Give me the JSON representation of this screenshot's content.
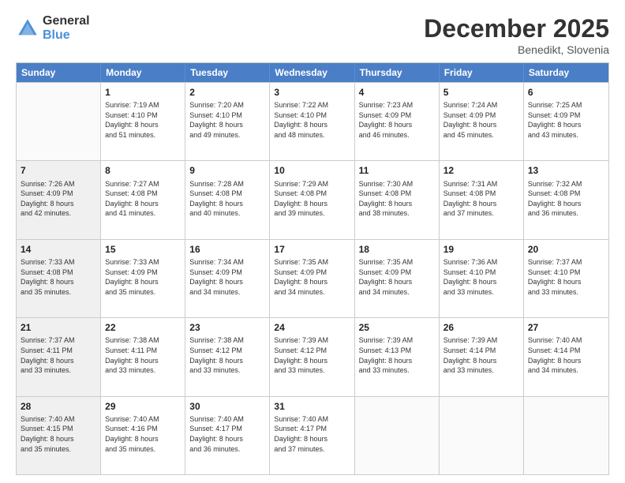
{
  "logo": {
    "general": "General",
    "blue": "Blue"
  },
  "header": {
    "title": "December 2025",
    "subtitle": "Benedikt, Slovenia"
  },
  "weekdays": [
    "Sunday",
    "Monday",
    "Tuesday",
    "Wednesday",
    "Thursday",
    "Friday",
    "Saturday"
  ],
  "rows": [
    [
      {
        "day": "",
        "info": "",
        "shaded": false,
        "empty": true
      },
      {
        "day": "1",
        "info": "Sunrise: 7:19 AM\nSunset: 4:10 PM\nDaylight: 8 hours\nand 51 minutes.",
        "shaded": false,
        "empty": false
      },
      {
        "day": "2",
        "info": "Sunrise: 7:20 AM\nSunset: 4:10 PM\nDaylight: 8 hours\nand 49 minutes.",
        "shaded": false,
        "empty": false
      },
      {
        "day": "3",
        "info": "Sunrise: 7:22 AM\nSunset: 4:10 PM\nDaylight: 8 hours\nand 48 minutes.",
        "shaded": false,
        "empty": false
      },
      {
        "day": "4",
        "info": "Sunrise: 7:23 AM\nSunset: 4:09 PM\nDaylight: 8 hours\nand 46 minutes.",
        "shaded": false,
        "empty": false
      },
      {
        "day": "5",
        "info": "Sunrise: 7:24 AM\nSunset: 4:09 PM\nDaylight: 8 hours\nand 45 minutes.",
        "shaded": false,
        "empty": false
      },
      {
        "day": "6",
        "info": "Sunrise: 7:25 AM\nSunset: 4:09 PM\nDaylight: 8 hours\nand 43 minutes.",
        "shaded": false,
        "empty": false
      }
    ],
    [
      {
        "day": "7",
        "info": "Sunrise: 7:26 AM\nSunset: 4:09 PM\nDaylight: 8 hours\nand 42 minutes.",
        "shaded": true,
        "empty": false
      },
      {
        "day": "8",
        "info": "Sunrise: 7:27 AM\nSunset: 4:08 PM\nDaylight: 8 hours\nand 41 minutes.",
        "shaded": false,
        "empty": false
      },
      {
        "day": "9",
        "info": "Sunrise: 7:28 AM\nSunset: 4:08 PM\nDaylight: 8 hours\nand 40 minutes.",
        "shaded": false,
        "empty": false
      },
      {
        "day": "10",
        "info": "Sunrise: 7:29 AM\nSunset: 4:08 PM\nDaylight: 8 hours\nand 39 minutes.",
        "shaded": false,
        "empty": false
      },
      {
        "day": "11",
        "info": "Sunrise: 7:30 AM\nSunset: 4:08 PM\nDaylight: 8 hours\nand 38 minutes.",
        "shaded": false,
        "empty": false
      },
      {
        "day": "12",
        "info": "Sunrise: 7:31 AM\nSunset: 4:08 PM\nDaylight: 8 hours\nand 37 minutes.",
        "shaded": false,
        "empty": false
      },
      {
        "day": "13",
        "info": "Sunrise: 7:32 AM\nSunset: 4:08 PM\nDaylight: 8 hours\nand 36 minutes.",
        "shaded": false,
        "empty": false
      }
    ],
    [
      {
        "day": "14",
        "info": "Sunrise: 7:33 AM\nSunset: 4:08 PM\nDaylight: 8 hours\nand 35 minutes.",
        "shaded": true,
        "empty": false
      },
      {
        "day": "15",
        "info": "Sunrise: 7:33 AM\nSunset: 4:09 PM\nDaylight: 8 hours\nand 35 minutes.",
        "shaded": false,
        "empty": false
      },
      {
        "day": "16",
        "info": "Sunrise: 7:34 AM\nSunset: 4:09 PM\nDaylight: 8 hours\nand 34 minutes.",
        "shaded": false,
        "empty": false
      },
      {
        "day": "17",
        "info": "Sunrise: 7:35 AM\nSunset: 4:09 PM\nDaylight: 8 hours\nand 34 minutes.",
        "shaded": false,
        "empty": false
      },
      {
        "day": "18",
        "info": "Sunrise: 7:35 AM\nSunset: 4:09 PM\nDaylight: 8 hours\nand 34 minutes.",
        "shaded": false,
        "empty": false
      },
      {
        "day": "19",
        "info": "Sunrise: 7:36 AM\nSunset: 4:10 PM\nDaylight: 8 hours\nand 33 minutes.",
        "shaded": false,
        "empty": false
      },
      {
        "day": "20",
        "info": "Sunrise: 7:37 AM\nSunset: 4:10 PM\nDaylight: 8 hours\nand 33 minutes.",
        "shaded": false,
        "empty": false
      }
    ],
    [
      {
        "day": "21",
        "info": "Sunrise: 7:37 AM\nSunset: 4:11 PM\nDaylight: 8 hours\nand 33 minutes.",
        "shaded": true,
        "empty": false
      },
      {
        "day": "22",
        "info": "Sunrise: 7:38 AM\nSunset: 4:11 PM\nDaylight: 8 hours\nand 33 minutes.",
        "shaded": false,
        "empty": false
      },
      {
        "day": "23",
        "info": "Sunrise: 7:38 AM\nSunset: 4:12 PM\nDaylight: 8 hours\nand 33 minutes.",
        "shaded": false,
        "empty": false
      },
      {
        "day": "24",
        "info": "Sunrise: 7:39 AM\nSunset: 4:12 PM\nDaylight: 8 hours\nand 33 minutes.",
        "shaded": false,
        "empty": false
      },
      {
        "day": "25",
        "info": "Sunrise: 7:39 AM\nSunset: 4:13 PM\nDaylight: 8 hours\nand 33 minutes.",
        "shaded": false,
        "empty": false
      },
      {
        "day": "26",
        "info": "Sunrise: 7:39 AM\nSunset: 4:14 PM\nDaylight: 8 hours\nand 33 minutes.",
        "shaded": false,
        "empty": false
      },
      {
        "day": "27",
        "info": "Sunrise: 7:40 AM\nSunset: 4:14 PM\nDaylight: 8 hours\nand 34 minutes.",
        "shaded": false,
        "empty": false
      }
    ],
    [
      {
        "day": "28",
        "info": "Sunrise: 7:40 AM\nSunset: 4:15 PM\nDaylight: 8 hours\nand 35 minutes.",
        "shaded": true,
        "empty": false
      },
      {
        "day": "29",
        "info": "Sunrise: 7:40 AM\nSunset: 4:16 PM\nDaylight: 8 hours\nand 35 minutes.",
        "shaded": false,
        "empty": false
      },
      {
        "day": "30",
        "info": "Sunrise: 7:40 AM\nSunset: 4:17 PM\nDaylight: 8 hours\nand 36 minutes.",
        "shaded": false,
        "empty": false
      },
      {
        "day": "31",
        "info": "Sunrise: 7:40 AM\nSunset: 4:17 PM\nDaylight: 8 hours\nand 37 minutes.",
        "shaded": false,
        "empty": false
      },
      {
        "day": "",
        "info": "",
        "shaded": false,
        "empty": true
      },
      {
        "day": "",
        "info": "",
        "shaded": false,
        "empty": true
      },
      {
        "day": "",
        "info": "",
        "shaded": false,
        "empty": true
      }
    ]
  ]
}
